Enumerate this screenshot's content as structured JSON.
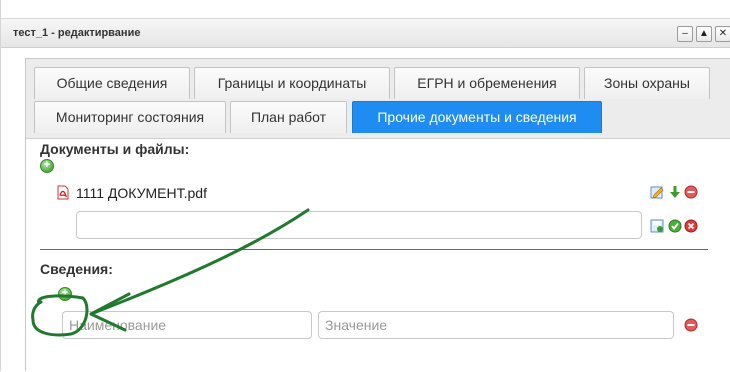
{
  "window": {
    "title": "тест_1 - редактирвание",
    "buttons": [
      "–",
      "▲",
      "✕"
    ]
  },
  "tabs": {
    "row1": [
      "Общие сведения",
      "Границы и координаты",
      "ЕГРН и обременения",
      "Зоны охраны"
    ],
    "row2": [
      "Мониторинг состояния",
      "План работ",
      "Прочие документы и сведения"
    ],
    "active": "Прочие документы и сведения"
  },
  "documents": {
    "label": "Документы и файлы:",
    "file_name": "1111 ДОКУМЕНТ.pdf",
    "new_file_value": ""
  },
  "info": {
    "label": "Сведения:",
    "name_placeholder": "Наименование",
    "value_placeholder": "Значение"
  },
  "icons": {
    "add": "plus-circle-icon",
    "edit": "edit-icon",
    "download": "download-icon",
    "remove": "minus-circle-icon",
    "save": "save-icon",
    "confirm": "check-circle-icon",
    "cancel": "close-circle-icon",
    "pdf": "pdf-icon"
  },
  "colors": {
    "active_tab": "#1e8cf0",
    "divider": "#3a72b8",
    "annotation": "#1f7a2d"
  }
}
